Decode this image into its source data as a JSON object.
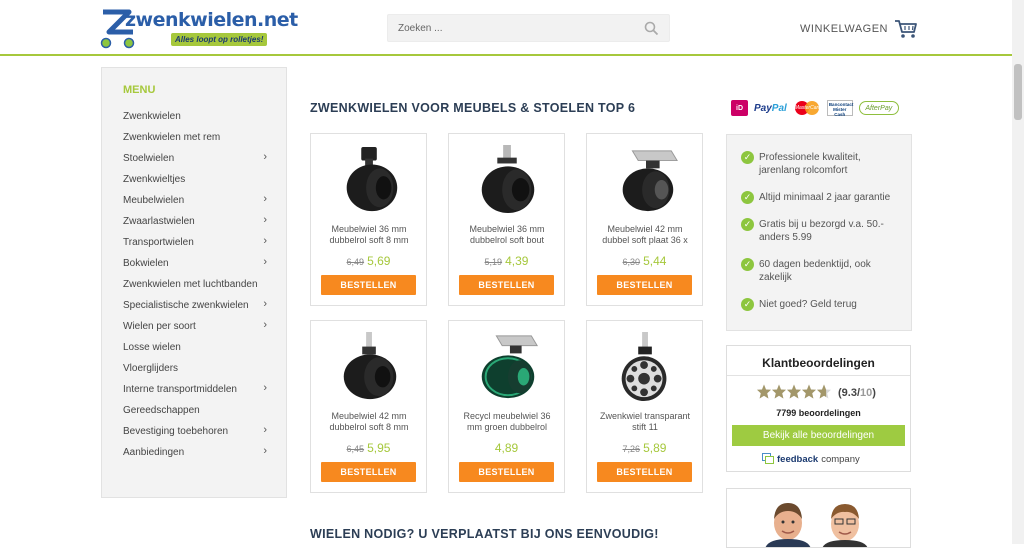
{
  "header": {
    "logo_text": "zwenkwielen.net",
    "logo_tagline": "Alles loopt op rolletjes!",
    "search_placeholder": "Zoeken ...",
    "cart_label": "WINKELWAGEN"
  },
  "sidebar": {
    "title": "MENU",
    "items": [
      {
        "label": "Zwenkwielen",
        "has_sub": false
      },
      {
        "label": "Zwenkwielen met rem",
        "has_sub": false
      },
      {
        "label": "Stoelwielen",
        "has_sub": true
      },
      {
        "label": "Zwenkwieltjes",
        "has_sub": false
      },
      {
        "label": "Meubelwielen",
        "has_sub": true
      },
      {
        "label": "Zwaarlastwielen",
        "has_sub": true
      },
      {
        "label": "Transportwielen",
        "has_sub": true
      },
      {
        "label": "Bokwielen",
        "has_sub": true
      },
      {
        "label": "Zwenkwielen met luchtbanden",
        "has_sub": false
      },
      {
        "label": "Specialistische zwenkwielen",
        "has_sub": true
      },
      {
        "label": "Wielen per soort",
        "has_sub": true
      },
      {
        "label": "Losse wielen",
        "has_sub": false
      },
      {
        "label": "Vloerglijders",
        "has_sub": false
      },
      {
        "label": "Interne transportmiddelen",
        "has_sub": true
      },
      {
        "label": "Gereedschappen",
        "has_sub": false
      },
      {
        "label": "Bevestiging toebehoren",
        "has_sub": true
      },
      {
        "label": "Aanbiedingen",
        "has_sub": true
      }
    ]
  },
  "main": {
    "title": "ZWENKWIELEN VOOR MEUBELS & STOELEN TOP 6",
    "title2": "WIELEN NODIG? U VERPLAATST BIJ ONS EENVOUDIG!",
    "button_label": "BESTELLEN",
    "products": [
      {
        "name": "Meubelwiel 36 mm dubbelrol soft 8 mm",
        "old_price": "6,49",
        "price": "5,69",
        "image": "caster-stem"
      },
      {
        "name": "Meubelwiel 36 mm dubbelrol soft bout",
        "old_price": "5,19",
        "price": "4,39",
        "image": "caster-bolt"
      },
      {
        "name": "Meubelwiel 42 mm dubbel soft plaat 36 x",
        "old_price": "6,30",
        "price": "5,44",
        "image": "caster-plate"
      },
      {
        "name": "Meubelwiel 42 mm dubbelrol soft 8 mm",
        "old_price": "6,45",
        "price": "5,95",
        "image": "caster-stem-grey"
      },
      {
        "name": "Recycl meubelwiel 36 mm groen dubbelrol",
        "old_price": "",
        "price": "4,89",
        "image": "caster-green"
      },
      {
        "name": "Zwenkwiel transparant stift 11",
        "old_price": "7,26",
        "price": "5,89",
        "image": "caster-transparent"
      }
    ]
  },
  "payment": {
    "ideal": "iD",
    "paypal_a": "Pay",
    "paypal_b": "Pal",
    "mastercard": "MasterCard",
    "bancontact": "Bancontact Mister Cash",
    "afterpay": "AfterPay"
  },
  "usps": [
    "Professionele kwaliteit, jarenlang rolcomfort",
    "Altijd minimaal 2 jaar garantie",
    "Gratis bij u bezorgd v.a. 50.- anders 5.99",
    "60 dagen bedenktijd, ook zakelijk",
    "Niet goed? Geld terug"
  ],
  "reviews": {
    "title": "Klantbeoordelingen",
    "rating": 9.3,
    "score": "(9.3/",
    "score_max": "10",
    "score_close": ")",
    "count": "7799 beoordelingen",
    "button": "Bekijk alle beoordelingen",
    "brand_bold": "feedback",
    "brand_rest": "company"
  },
  "colors": {
    "accent_green": "#a6c83c",
    "order_orange": "#f7891f",
    "title_navy": "#2c3e55"
  }
}
